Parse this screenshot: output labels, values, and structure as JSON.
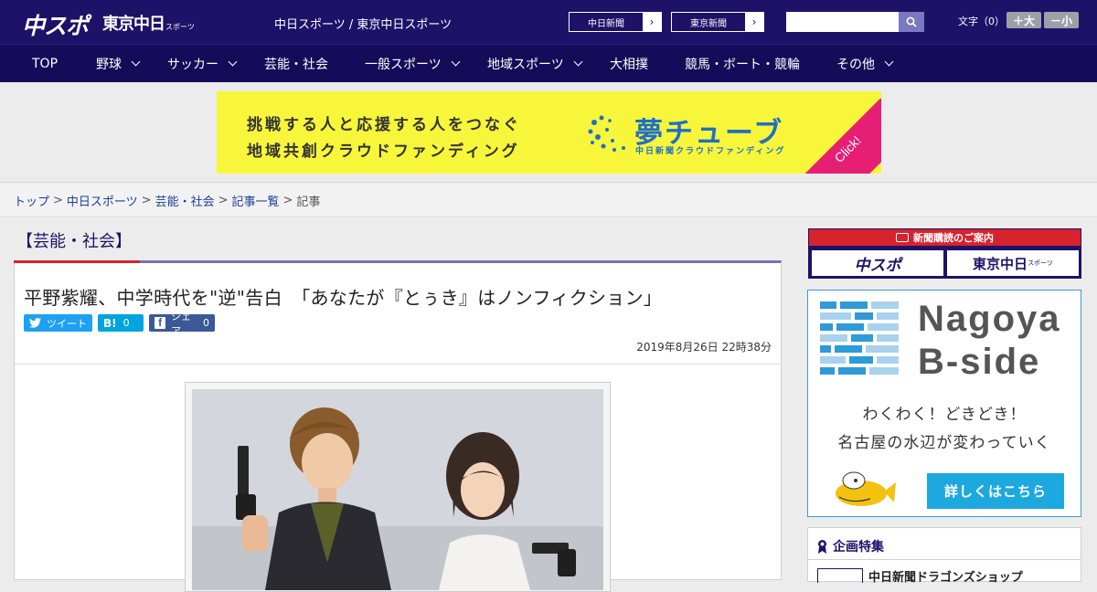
{
  "header": {
    "logo_main": "中スポ",
    "logo_second": "東京中日",
    "logo_second_small": "スポーツ",
    "site_title": "中日スポーツ / 東京中日スポーツ",
    "ext_links": [
      "中日新聞",
      "東京新聞"
    ],
    "search": {
      "placeholder": "",
      "button_icon": "search-icon"
    },
    "font_size_label": "文字（0）",
    "font_larger": "＋大",
    "font_smaller": "－小"
  },
  "nav": [
    {
      "label": "TOP",
      "dropdown": false
    },
    {
      "label": "野球",
      "dropdown": true
    },
    {
      "label": "サッカー",
      "dropdown": true
    },
    {
      "label": "芸能・社会",
      "dropdown": false
    },
    {
      "label": "一般スポーツ",
      "dropdown": true
    },
    {
      "label": "地域スポーツ",
      "dropdown": true
    },
    {
      "label": "大相撲",
      "dropdown": false
    },
    {
      "label": "競馬・ボート・競輪",
      "dropdown": false
    },
    {
      "label": "その他",
      "dropdown": true
    }
  ],
  "ad": {
    "line1": "挑戦する人と応援する人をつなぐ",
    "line2": "地域共創クラウドファンディング",
    "brand": "夢チューブ",
    "sub": "中日新聞クラウドファンディング",
    "click": "Click!",
    "colors": {
      "bg": "#f7f63a",
      "brand": "#1f6fc8",
      "click_bg": "#e61f74"
    }
  },
  "breadcrumb": [
    "トップ",
    "中日スポーツ",
    "芸能・社会",
    "記事一覧",
    "記事"
  ],
  "category": "【芸能・社会】",
  "article": {
    "headline": "平野紫耀、中学時代を\"逆\"告白　「あなたが『とぅき』はノンフィクション」",
    "share": {
      "tweet": "ツイート",
      "hatena_label": "B!",
      "hatena_count": "0",
      "facebook": "シェア",
      "facebook_count": "0"
    },
    "date": "2019年8月26日 22時38分"
  },
  "sidebar": {
    "subscribe_head": "新聞購読のご案内",
    "subscribe_logos": [
      "中スポ",
      "東京中日"
    ],
    "subscribe_logo_small": "スポーツ",
    "bside_title1": "Nagoya",
    "bside_title2": "B-side",
    "bside_text1": "わくわく！どきどき！",
    "bside_text2": "名古屋の水辺が変わっていく",
    "bside_button": "詳しくはこちら",
    "feature_head": "企画特集",
    "feature_item": "中日新聞ドラゴンズショップ"
  },
  "colors": {
    "header": "#1d1268",
    "nav": "#160b58",
    "accent_red": "#d6232d",
    "link": "#1d3d9e",
    "twitter": "#1da1f2",
    "hatena": "#00a4de",
    "facebook": "#3b5998"
  }
}
